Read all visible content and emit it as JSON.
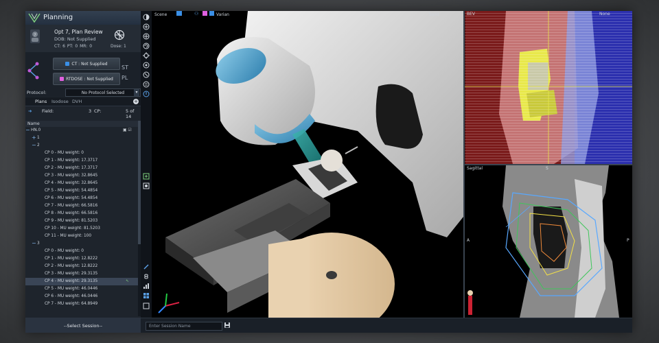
{
  "app": {
    "title": "Planning"
  },
  "patient": {
    "name": "Opt 7, Plan Review",
    "dob": "DOB: Not Supplied",
    "counts": "CT: 6   PT: 0   MR: 0",
    "dose": "Dose: 1"
  },
  "data_buttons": {
    "ct": "CT : Not Supplied",
    "rtdose": "RTDOSE : Not Supplied",
    "st": "ST",
    "pl": "PL"
  },
  "protocol": {
    "label": "Protocol:",
    "selected": "No Protocol Selected"
  },
  "tabs": [
    "Plans",
    "Isodose",
    "DVH"
  ],
  "field": {
    "label": "Field:",
    "value": "3",
    "cp_label": "CP:",
    "cp_value": "5 of 14"
  },
  "list": {
    "header": "Name",
    "rows": [
      {
        "text": "HN.0",
        "indent": 8,
        "pm": "−"
      },
      {
        "text": "1",
        "indent": 17,
        "pm": "+"
      },
      {
        "text": "2",
        "indent": 17,
        "pm": "−"
      },
      {
        "text": "CP 0 - MU weight: 0",
        "indent": 28
      },
      {
        "text": "CP 1 - MU weight: 17.3717",
        "indent": 28
      },
      {
        "text": "CP 2 - MU weight: 17.3717",
        "indent": 28
      },
      {
        "text": "CP 3 - MU weight: 32.8645",
        "indent": 28
      },
      {
        "text": "CP 4 - MU weight: 32.8645",
        "indent": 28
      },
      {
        "text": "CP 5 - MU weight: 54.4854",
        "indent": 28
      },
      {
        "text": "CP 6 - MU weight: 54.4854",
        "indent": 28
      },
      {
        "text": "CP 7 - MU weight: 66.5816",
        "indent": 28
      },
      {
        "text": "CP 8 - MU weight: 66.5816",
        "indent": 28
      },
      {
        "text": "CP 9 - MU weight: 81.5203",
        "indent": 28
      },
      {
        "text": "CP 10 - MU weight: 81.5203",
        "indent": 28
      },
      {
        "text": "CP 11 - MU weight: 100",
        "indent": 28
      },
      {
        "text": "3",
        "indent": 17,
        "pm": "−"
      },
      {
        "text": "CP 0 - MU weight: 0",
        "indent": 28
      },
      {
        "text": "CP 1 - MU weight: 12.8222",
        "indent": 28
      },
      {
        "text": "CP 2 - MU weight: 12.8222",
        "indent": 28
      },
      {
        "text": "CP 3 - MU weight: 29.3135",
        "indent": 28
      },
      {
        "text": "CP 4 - MU weight: 29.3135",
        "indent": 28,
        "selected": true
      },
      {
        "text": "CP 5 - MU weight: 46.0446",
        "indent": 28
      },
      {
        "text": "CP 6 - MU weight: 46.0446",
        "indent": 28
      },
      {
        "text": "CP 7 - MU weight: 64.8949",
        "indent": 28
      }
    ]
  },
  "bottom": {
    "session_select": "--Select Session--",
    "session_placeholder": "Enter Session Name"
  },
  "scene": {
    "label": "Scene",
    "machine": "Varian",
    "render": "Solid"
  },
  "bev": {
    "label": "BEV",
    "overlay": "None"
  },
  "sagittal": {
    "label": "Sagittal",
    "left": "A",
    "right": "P",
    "top": "S"
  },
  "colors": {
    "accent": "#2f6fb3",
    "selection": "#3a4556",
    "bev_blue": "#2b2fae",
    "bev_red": "#7a1a1a",
    "tumor_yellow": "#e8e84a"
  }
}
